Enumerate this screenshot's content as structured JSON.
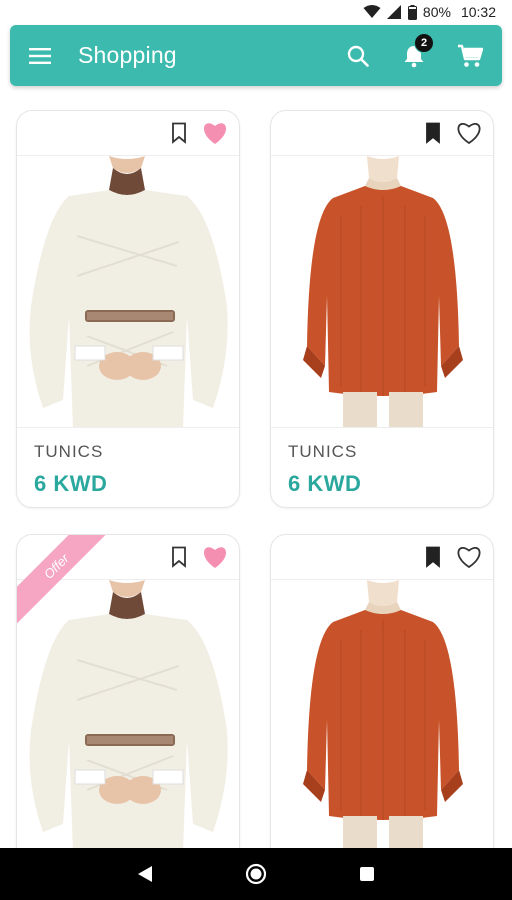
{
  "status_bar": {
    "battery": "80%",
    "time": "10:32"
  },
  "app_bar": {
    "title": "Shopping",
    "notification_count": "2"
  },
  "products": [
    {
      "category": "TUNICS",
      "price": "6 KWD",
      "bookmarked": false,
      "liked": true,
      "variant": "cream"
    },
    {
      "category": "TUNICS",
      "price": "6 KWD",
      "bookmarked": true,
      "liked": false,
      "variant": "rust"
    },
    {
      "category": "",
      "price": "",
      "bookmarked": false,
      "liked": true,
      "variant": "cream",
      "ribbon": "Offer"
    },
    {
      "category": "",
      "price": "",
      "bookmarked": true,
      "liked": false,
      "variant": "rust"
    }
  ],
  "colors": {
    "primary": "#3dbaae",
    "price": "#2aa89d",
    "like": "#f48fb1",
    "ribbon": "#f6a6c3"
  }
}
